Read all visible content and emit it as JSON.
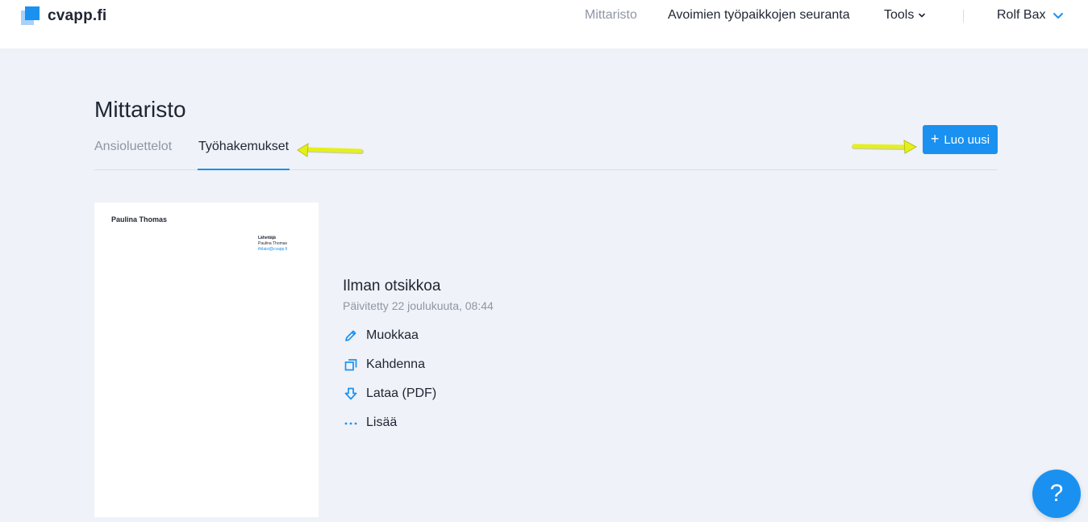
{
  "brand": {
    "name": "cvapp.fi"
  },
  "nav": {
    "dashboard": "Mittaristo",
    "job_tracking": "Avoimien työpaikkojen seuranta",
    "tools": "Tools",
    "user": "Rolf Bax"
  },
  "page": {
    "title": "Mittaristo",
    "tabs": [
      {
        "label": "Ansioluettelot",
        "active": false
      },
      {
        "label": "Työhakemukset",
        "active": true
      }
    ],
    "create_button": "Luo uusi"
  },
  "document": {
    "thumbnail": {
      "name": "Paulina Thomas",
      "recipient_lines": [
        "Lähettäjä",
        "Paulina Thomas",
        "thilaisi@cvapp.fi"
      ]
    },
    "title": "Ilman otsikkoa",
    "updated": "Päivitetty 22 joulukuuta, 08:44",
    "actions": [
      {
        "label": "Muokkaa",
        "icon": "pencil-icon"
      },
      {
        "label": "Kahdenna",
        "icon": "duplicate-icon"
      },
      {
        "label": "Lataa (PDF)",
        "icon": "download-icon"
      },
      {
        "label": "Lisää",
        "icon": "more-icon"
      }
    ]
  },
  "help": {
    "label": "?"
  },
  "colors": {
    "accent": "#1a91f0",
    "background": "#eff2f8",
    "text": "#1e2532",
    "muted": "#8f96a3",
    "annotation_arrow": "#e5f01a"
  }
}
